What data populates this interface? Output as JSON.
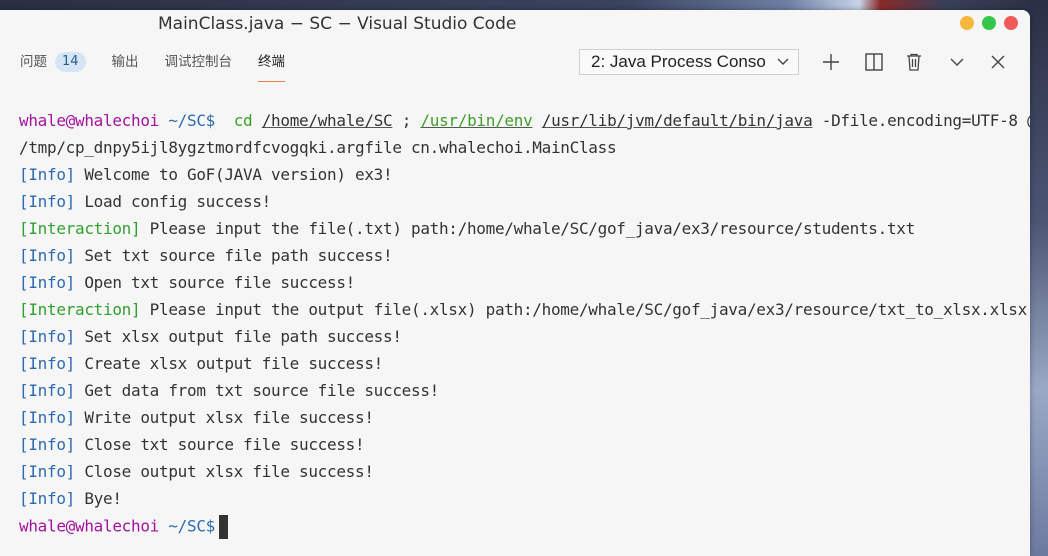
{
  "window": {
    "title": "MainClass.java − SC − Visual Studio Code"
  },
  "panel": {
    "tabs": [
      {
        "label": "问题",
        "badge": "14"
      },
      {
        "label": "输出"
      },
      {
        "label": "调试控制台"
      },
      {
        "label": "终端",
        "active": true
      }
    ],
    "terminal_select": "2: Java Process Conso",
    "icons": [
      "plus-icon",
      "split-icon",
      "trash-icon",
      "chevron-down-icon",
      "close-icon"
    ]
  },
  "terminal": {
    "prompt_user": "whale@whalechoi",
    "prompt_path": "~/SC$",
    "command": {
      "cd": "cd",
      "cd_path": "/home/whale/SC",
      "sep": ";",
      "env": "/usr/bin/env",
      "java": "/usr/lib/jvm/default/bin/java",
      "opts": "-Dfile.encoding=UTF-8 @",
      "line2": "/tmp/cp_dnpy5ijl8ygztmordfcvogqki.argfile cn.whalechoi.MainClass"
    },
    "output": [
      {
        "tag": "[Info]",
        "type": "info",
        "text": " Welcome to GoF(JAVA version) ex3!"
      },
      {
        "tag": "[Info]",
        "type": "info",
        "text": " Load config success!"
      },
      {
        "tag": "[Interaction]",
        "type": "inter",
        "text": " Please input the file(.txt) path:/home/whale/SC/gof_java/ex3/resource/students.txt"
      },
      {
        "tag": "[Info]",
        "type": "info",
        "text": " Set txt source file path success!"
      },
      {
        "tag": "[Info]",
        "type": "info",
        "text": " Open txt source file success!"
      },
      {
        "tag": "[Interaction]",
        "type": "inter",
        "text": " Please input the output file(.xlsx) path:/home/whale/SC/gof_java/ex3/resource/txt_to_xlsx.xlsx"
      },
      {
        "tag": "[Info]",
        "type": "info",
        "text": " Set xlsx output file path success!"
      },
      {
        "tag": "[Info]",
        "type": "info",
        "text": " Create xlsx output file success!"
      },
      {
        "tag": "[Info]",
        "type": "info",
        "text": " Get data from txt source file success!"
      },
      {
        "tag": "[Info]",
        "type": "info",
        "text": " Write output xlsx file success!"
      },
      {
        "tag": "[Info]",
        "type": "info",
        "text": " Close txt source file success!"
      },
      {
        "tag": "[Info]",
        "type": "info",
        "text": " Close output xlsx file success!"
      },
      {
        "tag": "[Info]",
        "type": "info",
        "text": " Bye!"
      }
    ]
  },
  "colors": {
    "user": "#a1129e",
    "path": "#2a6bb0",
    "command": "#3e9e2a",
    "info": "#2d6ab1",
    "interaction": "#2fa12f",
    "active_tab_underline": "#e8804a"
  }
}
